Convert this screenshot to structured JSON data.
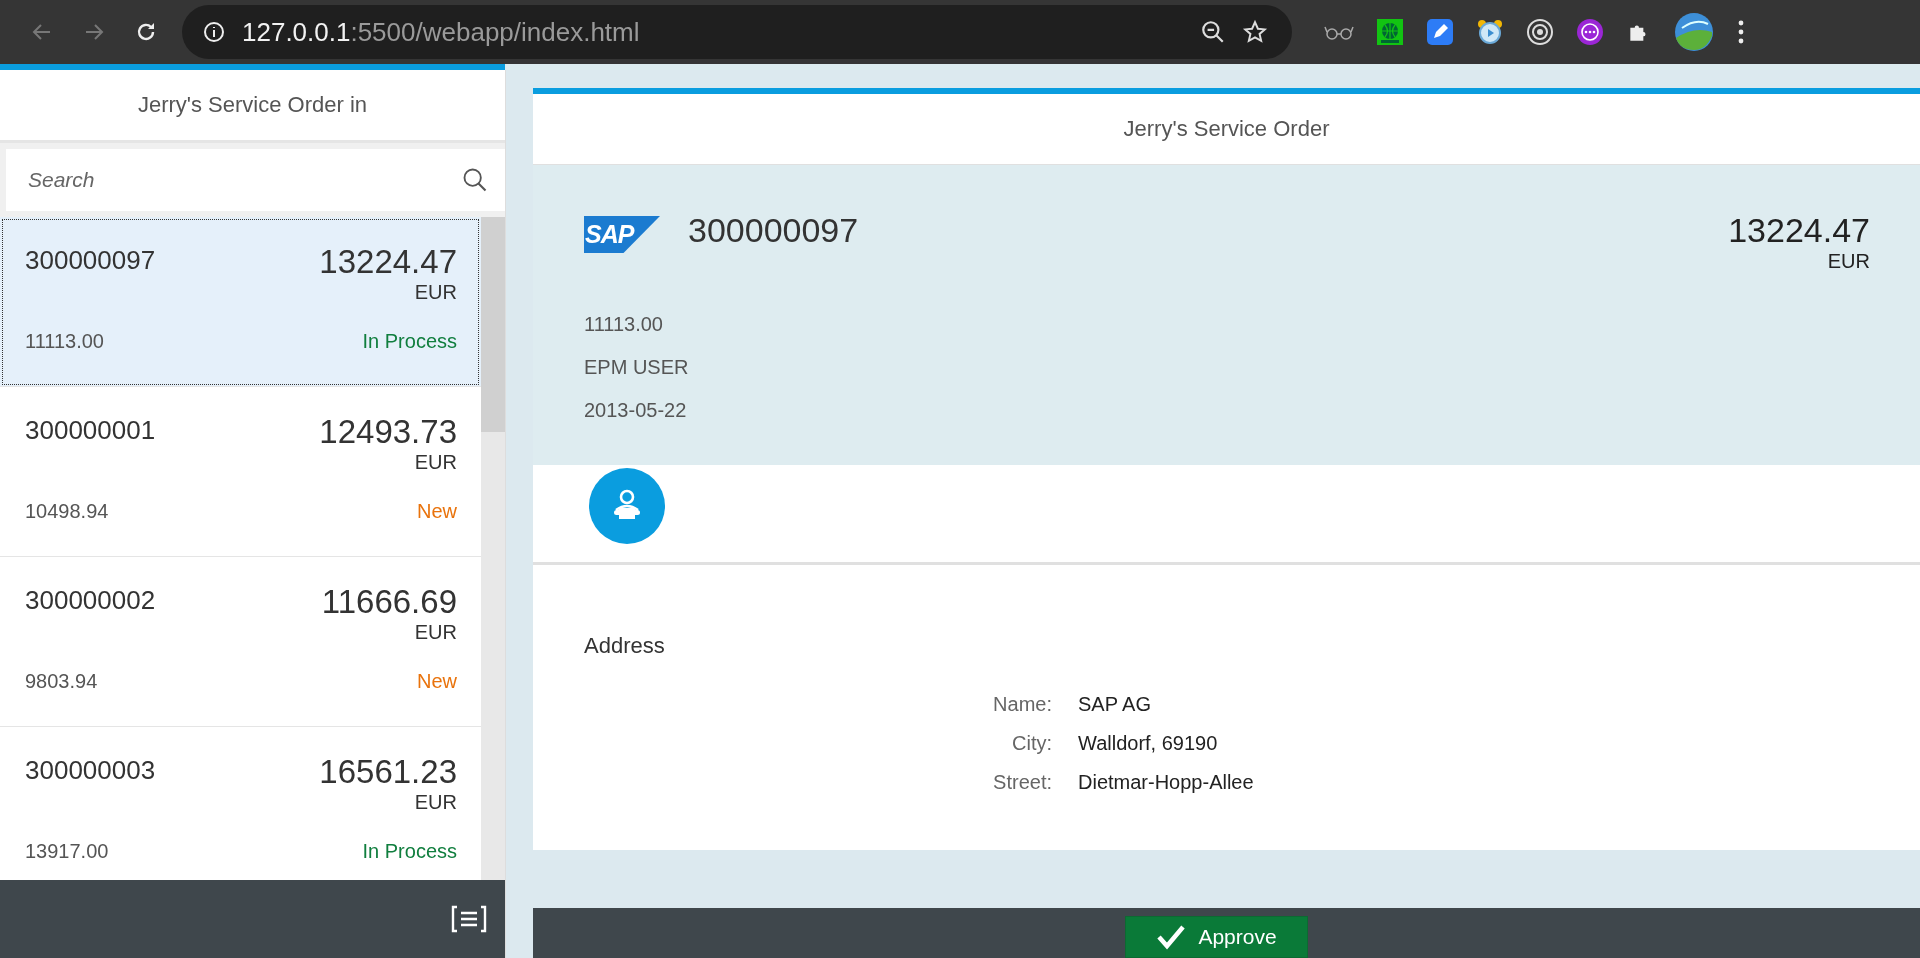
{
  "browser": {
    "url_host": "127.0.0.1",
    "url_rest": ":5500/webapp/index.html"
  },
  "master": {
    "title": "Jerry's Service Order in",
    "search": {
      "placeholder": "Search"
    },
    "items": [
      {
        "number": "300000097",
        "amount": "13224.47",
        "currency": "EUR",
        "sub": "11113.00",
        "status": "In Process",
        "color": "#107e3e",
        "selected": true
      },
      {
        "number": "300000001",
        "amount": "12493.73",
        "currency": "EUR",
        "sub": "10498.94",
        "status": "New",
        "color": "#e9730c",
        "selected": false
      },
      {
        "number": "300000002",
        "amount": "11666.69",
        "currency": "EUR",
        "sub": "9803.94",
        "status": "New",
        "color": "#e9730c",
        "selected": false
      },
      {
        "number": "300000003",
        "amount": "16561.23",
        "currency": "EUR",
        "sub": "13917.00",
        "status": "In Process",
        "color": "#107e3e",
        "selected": false
      }
    ]
  },
  "detail": {
    "title": "Jerry's Service Order",
    "logo_text": "SAP",
    "number": "300000097",
    "amount": "13224.47",
    "currency": "EUR",
    "attributes": [
      "11113.00",
      "EPM USER",
      "2013-05-22"
    ],
    "address": {
      "heading": "Address",
      "fields": [
        {
          "label": "Name:",
          "value": "SAP AG"
        },
        {
          "label": "City:",
          "value": "Walldorf, 69190"
        },
        {
          "label": "Street:",
          "value": "Dietmar-Hopp-Allee"
        }
      ]
    },
    "footer": {
      "approve": "Approve"
    }
  }
}
